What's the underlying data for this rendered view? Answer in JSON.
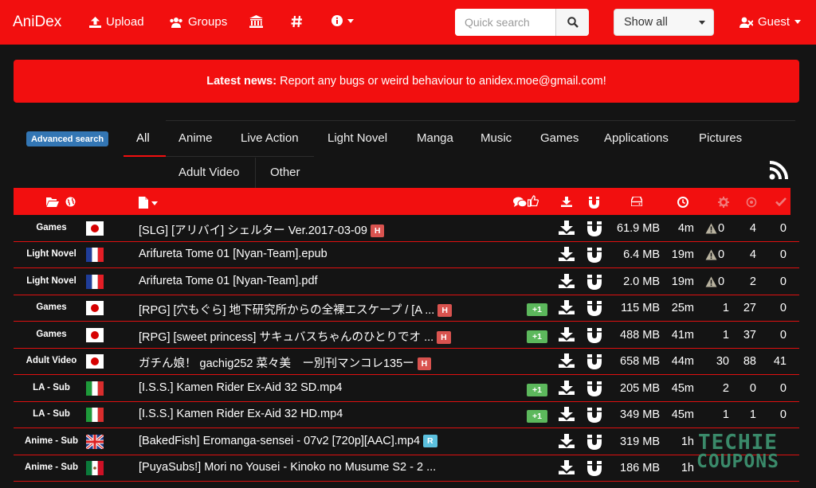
{
  "nav": {
    "brand": "AniDex",
    "upload": "Upload",
    "groups": "Groups",
    "search_placeholder": "Quick search",
    "filter": "Show all",
    "user": "Guest"
  },
  "news": {
    "label": "Latest news:",
    "text": "Report any bugs or weird behaviour to anidex.moe@gmail.com!"
  },
  "advanced_search": "Advanced search",
  "categories": [
    "All",
    "Anime",
    "Live Action",
    "Light Novel",
    "Manga",
    "Music",
    "Games",
    "Applications",
    "Pictures",
    "Adult Video",
    "Other"
  ],
  "rows": [
    {
      "category": "Games",
      "flag": "jp",
      "name": "[SLG] [アリバイ] シェルター Ver.2017-03-09",
      "badge": "H",
      "plus": "",
      "size": "61.9 MB",
      "age": "4m",
      "warn": "0",
      "seeders": "",
      "leechers": "4",
      "completed": "0"
    },
    {
      "category": "Light Novel",
      "flag": "fr",
      "name": "Arifureta Tome 01 [Nyan-Team].epub",
      "badge": "",
      "plus": "",
      "size": "6.4 MB",
      "age": "19m",
      "warn": "0",
      "seeders": "",
      "leechers": "4",
      "completed": "0"
    },
    {
      "category": "Light Novel",
      "flag": "fr",
      "name": "Arifureta Tome 01 [Nyan-Team].pdf",
      "badge": "",
      "plus": "",
      "size": "2.0 MB",
      "age": "19m",
      "warn": "0",
      "seeders": "",
      "leechers": "2",
      "completed": "0"
    },
    {
      "category": "Games",
      "flag": "jp",
      "name": "[RPG] [穴もぐら] 地下研究所からの全裸エスケープ / [A ...",
      "badge": "H",
      "plus": "+1",
      "size": "115 MB",
      "age": "25m",
      "warn": "",
      "seeders": "1",
      "leechers": "27",
      "completed": "0"
    },
    {
      "category": "Games",
      "flag": "jp",
      "name": "[RPG] [sweet princess] サキュバスちゃんのひとりでオ ...",
      "badge": "H",
      "plus": "+1",
      "size": "488 MB",
      "age": "41m",
      "warn": "",
      "seeders": "1",
      "leechers": "37",
      "completed": "0"
    },
    {
      "category": "Adult Video",
      "flag": "jp",
      "name": "ガチん娘！ gachig252 菜々美　ー別刊マンコレ135ー",
      "badge": "H",
      "plus": "",
      "size": "658 MB",
      "age": "44m",
      "warn": "",
      "seeders": "30",
      "leechers": "88",
      "completed": "41"
    },
    {
      "category": "LA - Sub",
      "flag": "it",
      "name": "[I.S.S.] Kamen Rider Ex-Aid 32 SD.mp4",
      "badge": "",
      "plus": "+1",
      "size": "205 MB",
      "age": "45m",
      "warn": "",
      "seeders": "2",
      "leechers": "0",
      "completed": "0"
    },
    {
      "category": "LA - Sub",
      "flag": "it",
      "name": "[I.S.S.] Kamen Rider Ex-Aid 32 HD.mp4",
      "badge": "",
      "plus": "+1",
      "size": "349 MB",
      "age": "45m",
      "warn": "",
      "seeders": "1",
      "leechers": "1",
      "completed": "0"
    },
    {
      "category": "Anime - Sub",
      "flag": "uk",
      "name": "[BakedFish] Eromanga-sensei - 07v2 [720p][AAC].mp4",
      "badge": "R",
      "plus": "",
      "size": "319 MB",
      "age": "1h",
      "warn": "",
      "seeders": "",
      "leechers": "",
      "completed": ""
    },
    {
      "category": "Anime - Sub",
      "flag": "mx",
      "name": "[PuyaSubs!] Mori no Yousei - Kinoko no Musume S2 - 2 ...",
      "badge": "",
      "plus": "",
      "size": "186 MB",
      "age": "1h",
      "warn": "",
      "seeders": "",
      "leechers": "",
      "completed": ""
    }
  ],
  "watermark": {
    "line1": "TECHIE",
    "line2": "COUPONS"
  },
  "colors": {
    "accent": "#f20f0f",
    "background": "#141414",
    "advanced": "#3376b4",
    "plus": "#5cb85c",
    "badge_h": "#d9534f",
    "badge_r": "#5bc0de"
  }
}
